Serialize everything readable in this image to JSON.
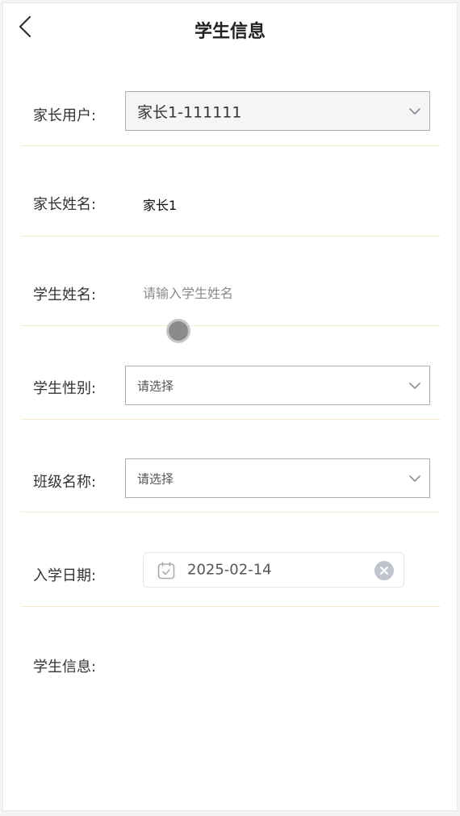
{
  "header": {
    "title": "学生信息",
    "back_icon": "chevron-left-icon"
  },
  "form": {
    "parent_user": {
      "label": "家长用户:",
      "value": "家长1-111111",
      "icon": "chevron-down-icon"
    },
    "parent_name": {
      "label": "家长姓名:",
      "value": "家长1"
    },
    "student_name": {
      "label": "学生姓名:",
      "value": "",
      "placeholder": "请输入学生姓名"
    },
    "student_gender": {
      "label": "学生性别:",
      "value": "请选择",
      "icon": "chevron-down-icon"
    },
    "class_name": {
      "label": "班级名称:",
      "value": "请选择",
      "icon": "chevron-down-icon"
    },
    "enroll_date": {
      "label": "入学日期:",
      "value": "2025-02-14",
      "icon": "calendar-icon",
      "clear_icon": "clear-icon"
    },
    "student_info": {
      "label": "学生信息:"
    }
  },
  "colors": {
    "divider": "#f8e8d2",
    "select_border": "#a9acb1",
    "filled_select_bg": "#f3f5f7",
    "placeholder": "#8a8a8a",
    "touch_indicator": "#8b8b8b"
  }
}
